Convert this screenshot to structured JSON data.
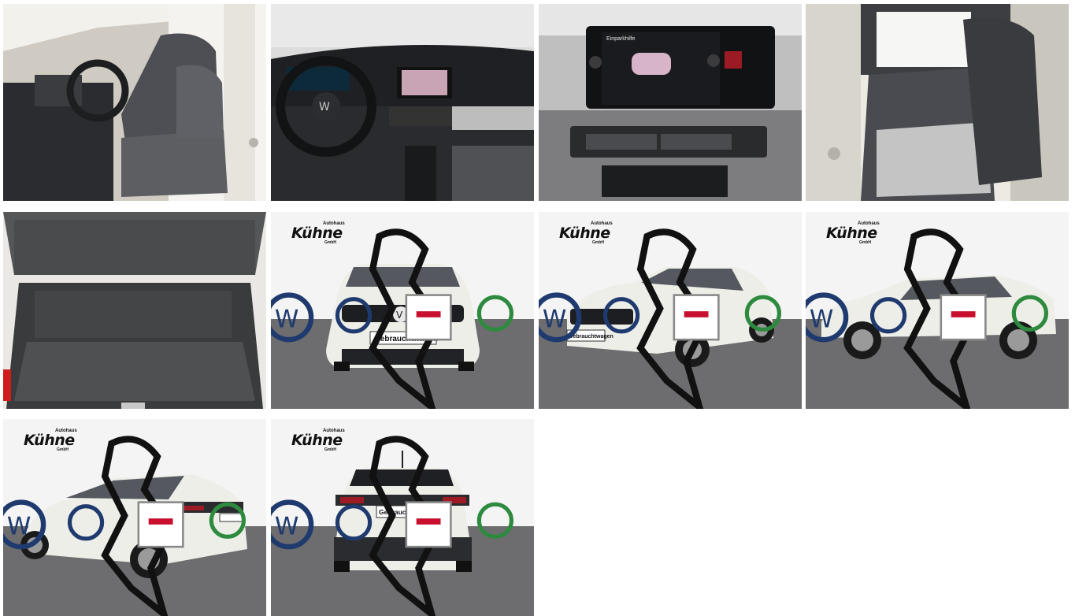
{
  "gallery": {
    "images": [
      {
        "id": 1,
        "subject": "front-seats"
      },
      {
        "id": 2,
        "subject": "cockpit"
      },
      {
        "id": 3,
        "subject": "infotainment"
      },
      {
        "id": 4,
        "subject": "rear-seats"
      },
      {
        "id": 5,
        "subject": "trunk"
      },
      {
        "id": 6,
        "subject": "car-front"
      },
      {
        "id": 7,
        "subject": "car-front-three-quarter"
      },
      {
        "id": 8,
        "subject": "car-side"
      },
      {
        "id": 9,
        "subject": "car-rear-three-quarter"
      },
      {
        "id": 10,
        "subject": "car-rear"
      }
    ]
  },
  "branding": {
    "dealer_name": "Kühne",
    "dealer_tag": "Autohaus",
    "dealer_suffix": "GmbH",
    "brand_logos": [
      "vw-logo",
      "vw-commercial-logo",
      "audi-logo",
      "skoda-logo"
    ]
  },
  "plates": {
    "front": "Gebrauchtwagen",
    "three_quarter": "Gebrauchtwagen",
    "rear": "Gebrauchtwagen"
  },
  "screen": {
    "header": "Einparkhilfe"
  },
  "colors": {
    "car_body": "#ecebe6",
    "floor": "#6b6b6d",
    "backdrop": "#f3f3f3",
    "vw_blue": "#1e3a6e",
    "skoda_green": "#2e8a3e",
    "audi_red": "#c8102e"
  }
}
